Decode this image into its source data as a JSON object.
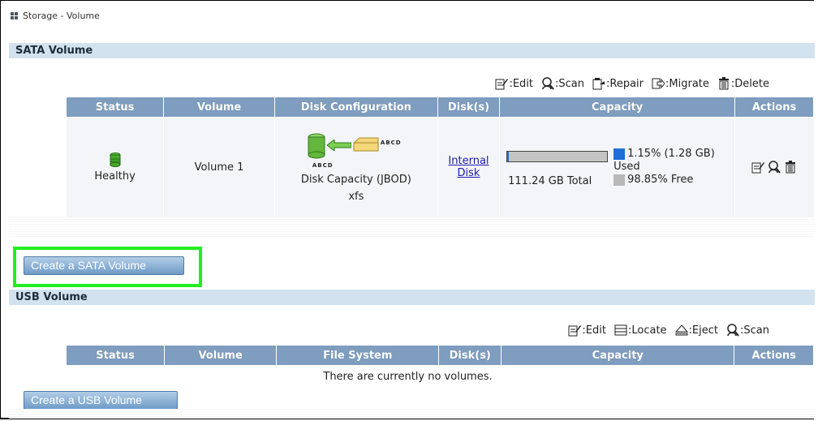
{
  "window": {
    "title": "Storage - Volume"
  },
  "sata": {
    "header": "SATA Volume",
    "legend": {
      "edit": ":Edit",
      "scan": ":Scan",
      "repair": ":Repair",
      "migrate": ":Migrate",
      "delete": ":Delete"
    },
    "columns": [
      "Status",
      "Volume",
      "Disk Configuration",
      "Disk(s)",
      "Capacity",
      "Actions"
    ],
    "row": {
      "status": "Healthy",
      "volume": "Volume 1",
      "disk_label_right": "ABCD",
      "disk_label_left": "ABCD",
      "config": "Disk Capacity (JBOD)",
      "fs": "xfs",
      "disks_line1": "Internal",
      "disks_line2": "Disk",
      "used_pct": 1.15,
      "used_text": "1.15% (1.28 GB)",
      "used_word": "Used",
      "total": "111.24 GB Total",
      "free_text": "98.85% Free"
    },
    "create_button": "Create a SATA Volume"
  },
  "usb": {
    "header": "USB Volume",
    "legend": {
      "edit": ":Edit",
      "locate": ":Locate",
      "eject": ":Eject",
      "scan": ":Scan"
    },
    "columns": [
      "Status",
      "Volume",
      "File System",
      "Disk(s)",
      "Capacity",
      "Actions"
    ],
    "empty_message": "There are currently no volumes.",
    "create_button": "Create a USB Volume"
  },
  "colors": {
    "header_bg": "#7e9dbf",
    "used": "#1e6fd8",
    "free": "#b8b8b8",
    "highlight": "#22ee22"
  },
  "icons": [
    "edit-icon",
    "scan-icon",
    "repair-icon",
    "migrate-icon",
    "delete-icon",
    "locate-icon",
    "eject-icon",
    "disk-healthy-icon"
  ]
}
